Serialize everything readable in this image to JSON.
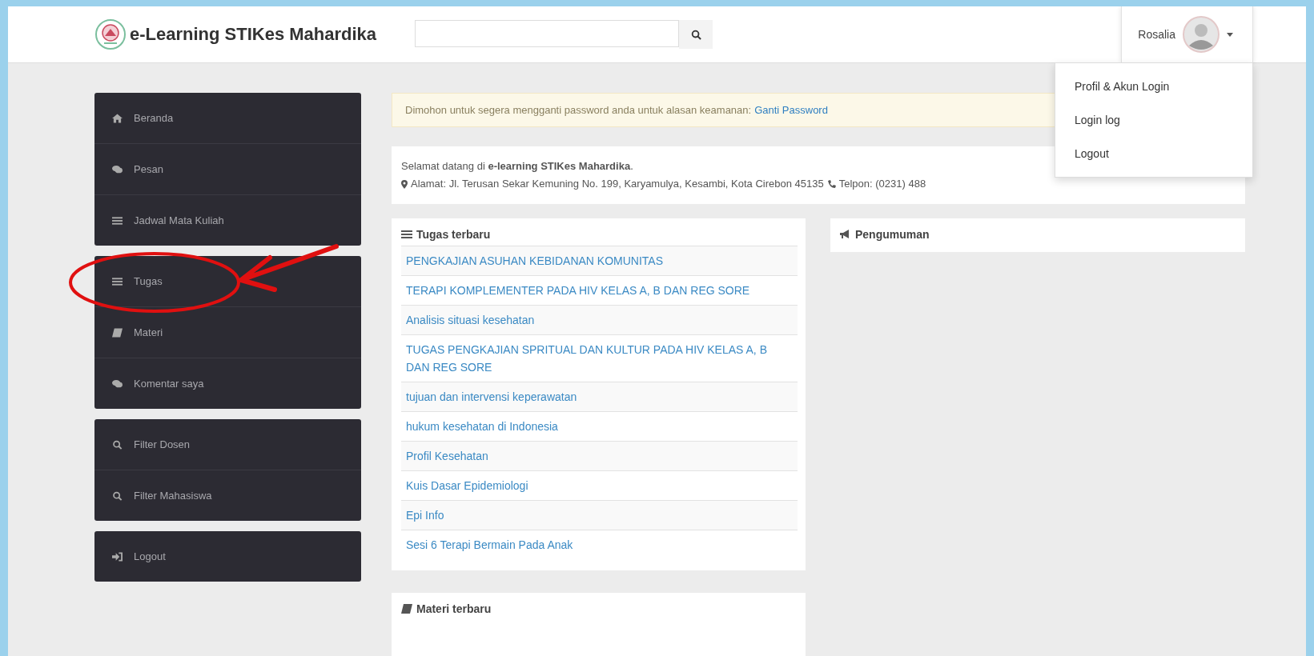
{
  "header": {
    "title": "e-Learning STIKes Mahardika",
    "user": {
      "name": "Rosalia",
      "menu_open": true,
      "menu": [
        "Profil & Akun Login",
        "Login log",
        "Logout"
      ]
    }
  },
  "sidebar": {
    "groups": [
      {
        "items": [
          {
            "label": "Beranda",
            "kind": "home"
          },
          {
            "label": "Pesan",
            "kind": "comments"
          },
          {
            "label": "Jadwal Mata Kuliah",
            "kind": "list"
          }
        ]
      },
      {
        "items": [
          {
            "label": "Tugas",
            "kind": "list"
          },
          {
            "label": "Materi",
            "kind": "book"
          },
          {
            "label": "Komentar saya",
            "kind": "comments"
          }
        ]
      },
      {
        "items": [
          {
            "label": "Filter Dosen",
            "kind": "search"
          },
          {
            "label": "Filter Mahasiswa",
            "kind": "search"
          }
        ]
      },
      {
        "items": [
          {
            "label": "Logout",
            "kind": "signin"
          }
        ]
      }
    ]
  },
  "alert": {
    "text": "Dimohon untuk segera mengganti password anda untuk alasan keamanan:",
    "link": "Ganti Password"
  },
  "welcome": {
    "text": "Selamat datang di **e-learning STIKes Mahardika**.",
    "address": "Alamat: Jl. Terusan Sekar Kemuning No. 199, Karyamulya, Kesambi, Kota Cirebon 45135",
    "phone": "Telpon: (0231) 488"
  },
  "tugas": {
    "title": "Tugas terbaru",
    "items": [
      "PENGKAJIAN ASUHAN KEBIDANAN KOMUNITAS",
      "TERAPI KOMPLEMENTER PADA HIV KELAS A, B DAN REG SORE",
      "Analisis situasi kesehatan",
      "TUGAS PENGKAJIAN SPRITUAL DAN KULTUR PADA HIV KELAS A, B DAN REG SORE",
      "tujuan dan intervensi keperawatan",
      "hukum kesehatan di Indonesia",
      "Profil Kesehatan",
      "Kuis Dasar Epidemiologi",
      "Epi Info",
      "Sesi 6 Terapi Bermain Pada Anak"
    ]
  },
  "pengumuman": {
    "title": "Pengumuman"
  },
  "materi": {
    "title": "Materi terbaru"
  }
}
